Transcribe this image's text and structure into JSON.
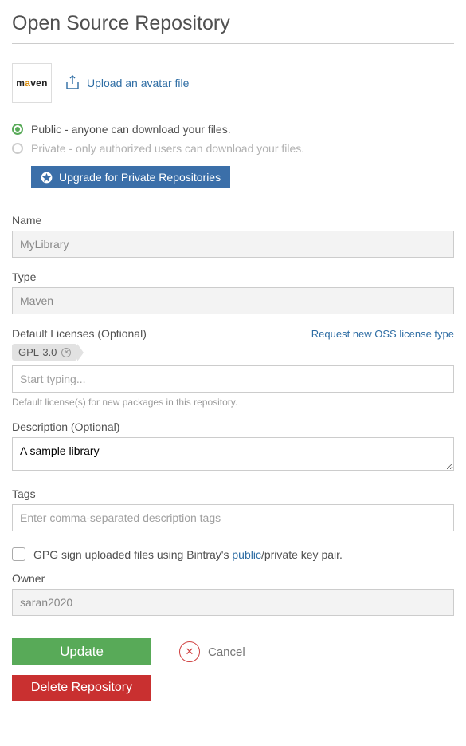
{
  "title": "Open Source Repository",
  "avatar": {
    "upload_label": "Upload an avatar file"
  },
  "visibility": {
    "public_label": "Public - anyone can download your files.",
    "private_label": "Private - only authorized users can download your files.",
    "upgrade_label": "Upgrade for Private Repositories"
  },
  "fields": {
    "name_label": "Name",
    "name_value": "MyLibrary",
    "type_label": "Type",
    "type_value": "Maven",
    "licenses_label": "Default Licenses (Optional)",
    "licenses_request_link": "Request new OSS license type",
    "licenses_tag": "GPL-3.0",
    "licenses_placeholder": "Start typing...",
    "licenses_hint": "Default license(s) for new packages in this repository.",
    "description_label": "Description (Optional)",
    "description_value": "A sample library",
    "tags_label": "Tags",
    "tags_placeholder": "Enter comma-separated description tags",
    "gpg_prefix": "GPG sign uploaded files using Bintray's ",
    "gpg_link": "public",
    "gpg_suffix": "/private key pair.",
    "owner_label": "Owner",
    "owner_value": "saran2020"
  },
  "actions": {
    "update": "Update",
    "cancel": "Cancel",
    "delete": "Delete Repository"
  }
}
